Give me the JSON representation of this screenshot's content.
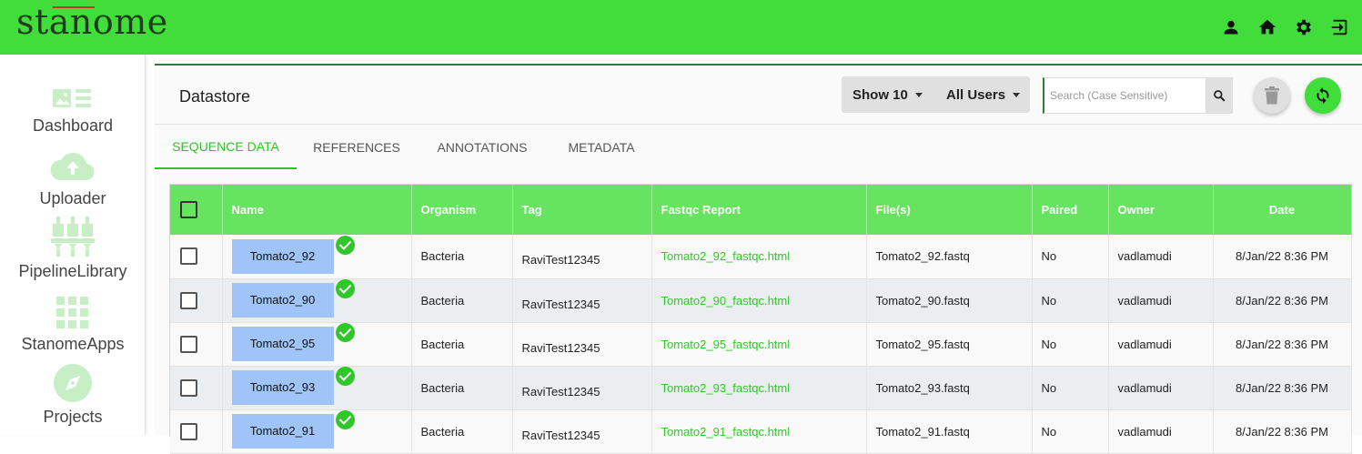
{
  "app": {
    "logo": "stanome"
  },
  "topbar": {
    "icons": [
      "user-icon",
      "home-icon",
      "gear-icon",
      "logout-icon"
    ]
  },
  "sidebar": {
    "items": [
      {
        "label": "Dashboard",
        "icon": "dashboard-icon"
      },
      {
        "label": "Uploader",
        "icon": "cloud-upload-icon"
      },
      {
        "label": "PipelineLibrary",
        "icon": "pipeline-icon"
      },
      {
        "label": "StanomeApps",
        "icon": "apps-grid-icon"
      },
      {
        "label": "Projects",
        "icon": "compass-icon"
      }
    ]
  },
  "header": {
    "title": "Datastore",
    "show_label": "Show 10",
    "users_label": "All Users",
    "search_placeholder": "Search (Case Sensitive)",
    "search_value": ""
  },
  "tabs": [
    {
      "label": "SEQUENCE DATA",
      "active": true
    },
    {
      "label": "REFERENCES",
      "active": false
    },
    {
      "label": "ANNOTATIONS",
      "active": false
    },
    {
      "label": "METADATA",
      "active": false
    }
  ],
  "table": {
    "columns": [
      "Name",
      "Organism",
      "Tag",
      "Fastqc Report",
      "File(s)",
      "Paired",
      "Owner",
      "Date"
    ],
    "rows": [
      {
        "name": "Tomato2_92",
        "organism": "Bacteria",
        "tag": "RaviTest12345",
        "fastqc": "Tomato2_92_fastqc.html",
        "files": "Tomato2_92.fastq",
        "paired": "No",
        "owner": "vadlamudi",
        "date": "8/Jan/22 8:36 PM"
      },
      {
        "name": "Tomato2_90",
        "organism": "Bacteria",
        "tag": "RaviTest12345",
        "fastqc": "Tomato2_90_fastqc.html",
        "files": "Tomato2_90.fastq",
        "paired": "No",
        "owner": "vadlamudi",
        "date": "8/Jan/22 8:36 PM"
      },
      {
        "name": "Tomato2_95",
        "organism": "Bacteria",
        "tag": "RaviTest12345",
        "fastqc": "Tomato2_95_fastqc.html",
        "files": "Tomato2_95.fastq",
        "paired": "No",
        "owner": "vadlamudi",
        "date": "8/Jan/22 8:36 PM"
      },
      {
        "name": "Tomato2_93",
        "organism": "Bacteria",
        "tag": "RaviTest12345",
        "fastqc": "Tomato2_93_fastqc.html",
        "files": "Tomato2_93.fastq",
        "paired": "No",
        "owner": "vadlamudi",
        "date": "8/Jan/22 8:36 PM"
      },
      {
        "name": "Tomato2_91",
        "organism": "Bacteria",
        "tag": "RaviTest12345",
        "fastqc": "Tomato2_91_fastqc.html",
        "files": "Tomato2_91.fastq",
        "paired": "No",
        "owner": "vadlamudi",
        "date": "8/Jan/22 8:36 PM"
      }
    ]
  },
  "colors": {
    "brand_green": "#41dd3a",
    "header_green": "#66e35f",
    "link_green": "#31c72b",
    "name_blue": "#9fc5f8"
  }
}
